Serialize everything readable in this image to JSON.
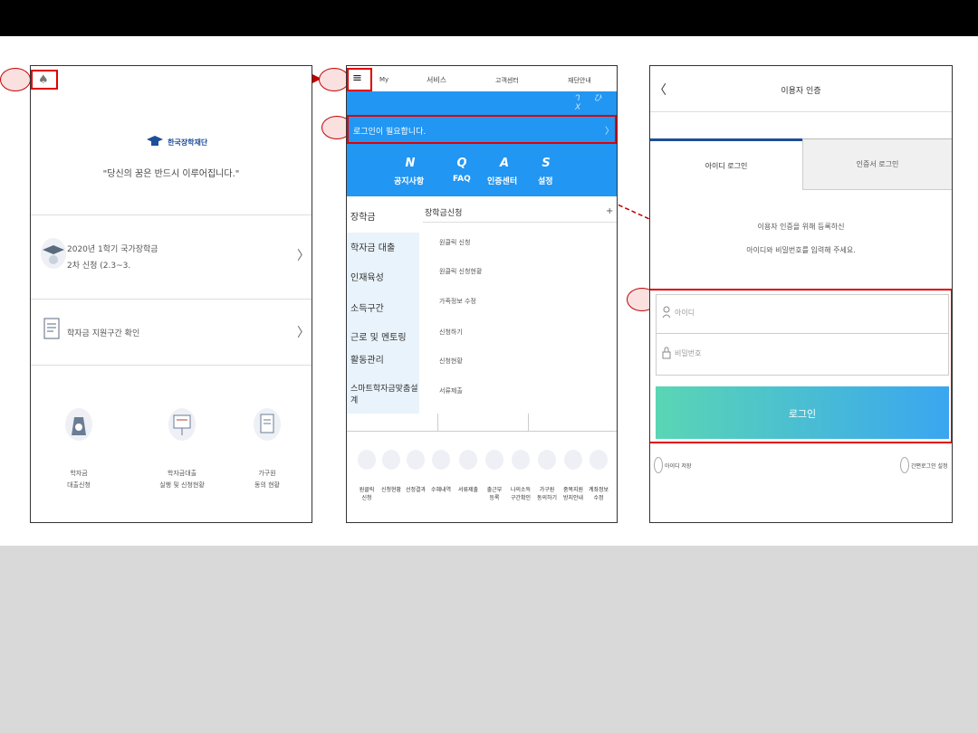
{
  "phone1": {
    "logo_text": "한국장학재단",
    "slogan": "\"당신의 꿈은 반드시 이루어집니다.\"",
    "row1_line1": "2020년 1학기 국가장학금",
    "row1_line2": "2차 신청 (2.3~3.",
    "row2_label": "학자금 지원구간 확인",
    "bottom": [
      {
        "label1": "학자금",
        "label2": "대출신청"
      },
      {
        "label1": "학자금대출",
        "label2": "실행 및 신청현황"
      },
      {
        "label1": "가구원",
        "label2": "동의 현황"
      }
    ]
  },
  "phone2": {
    "header": {
      "menu_icon": "≡",
      "my": "My",
      "service": "서비스",
      "support": "고객센터",
      "foundation": "재단안내"
    },
    "login_prompt": "로그인이 필요합니다.",
    "quick": [
      {
        "letter": "N",
        "label": "공지사항"
      },
      {
        "letter": "Q",
        "label": "FAQ"
      },
      {
        "letter": "A",
        "label": "인증센터"
      },
      {
        "letter": "S",
        "label": "설정"
      }
    ],
    "left_menu": [
      "장학금",
      "학자금 대출",
      "인재육성",
      "소득구간",
      "근로 및 멘토링",
      "활동관리",
      "스마트학자금맞춤설계"
    ],
    "right_header": "장학금신청",
    "right_plus": "+",
    "right_menu": [
      "원클릭 신청",
      "원클릭 신청현황",
      "가족정보 수정",
      "신청하기",
      "신청현황",
      "서류제출"
    ],
    "bottom_icons": [
      {
        "l1": "원클릭",
        "l2": "신청"
      },
      {
        "l1": "신청현황",
        "l2": ""
      },
      {
        "l1": "선정결과",
        "l2": ""
      },
      {
        "l1": "수혜내역",
        "l2": ""
      },
      {
        "l1": "서류제출",
        "l2": ""
      },
      {
        "l1": "출근부",
        "l2": "등록"
      },
      {
        "l1": "나의소득",
        "l2": "구간확인"
      },
      {
        "l1": "가구원",
        "l2": "동의하기"
      },
      {
        "l1": "중복지원",
        "l2": "방지안내"
      },
      {
        "l1": "계좌정보",
        "l2": "수정"
      }
    ]
  },
  "phone3": {
    "back": "〈",
    "title": "이용자 인증",
    "tab_id": "아이디 로그인",
    "tab_cert": "인증서 로그인",
    "desc1": "이용자 인증을 위해 등록하신",
    "desc2": "아이디와 비밀번호를 입력해 주세요.",
    "id_placeholder": "아이디",
    "pw_placeholder": "비밀번호",
    "login_button": "로그인",
    "save_id": "아이디 저장",
    "simple_login": "간편로그인 설정"
  },
  "colors": {
    "accent_blue": "#2196f3",
    "callout_red": "#e00000",
    "login_grad_start": "#5ad6b4",
    "login_grad_end": "#3aa6f0"
  }
}
